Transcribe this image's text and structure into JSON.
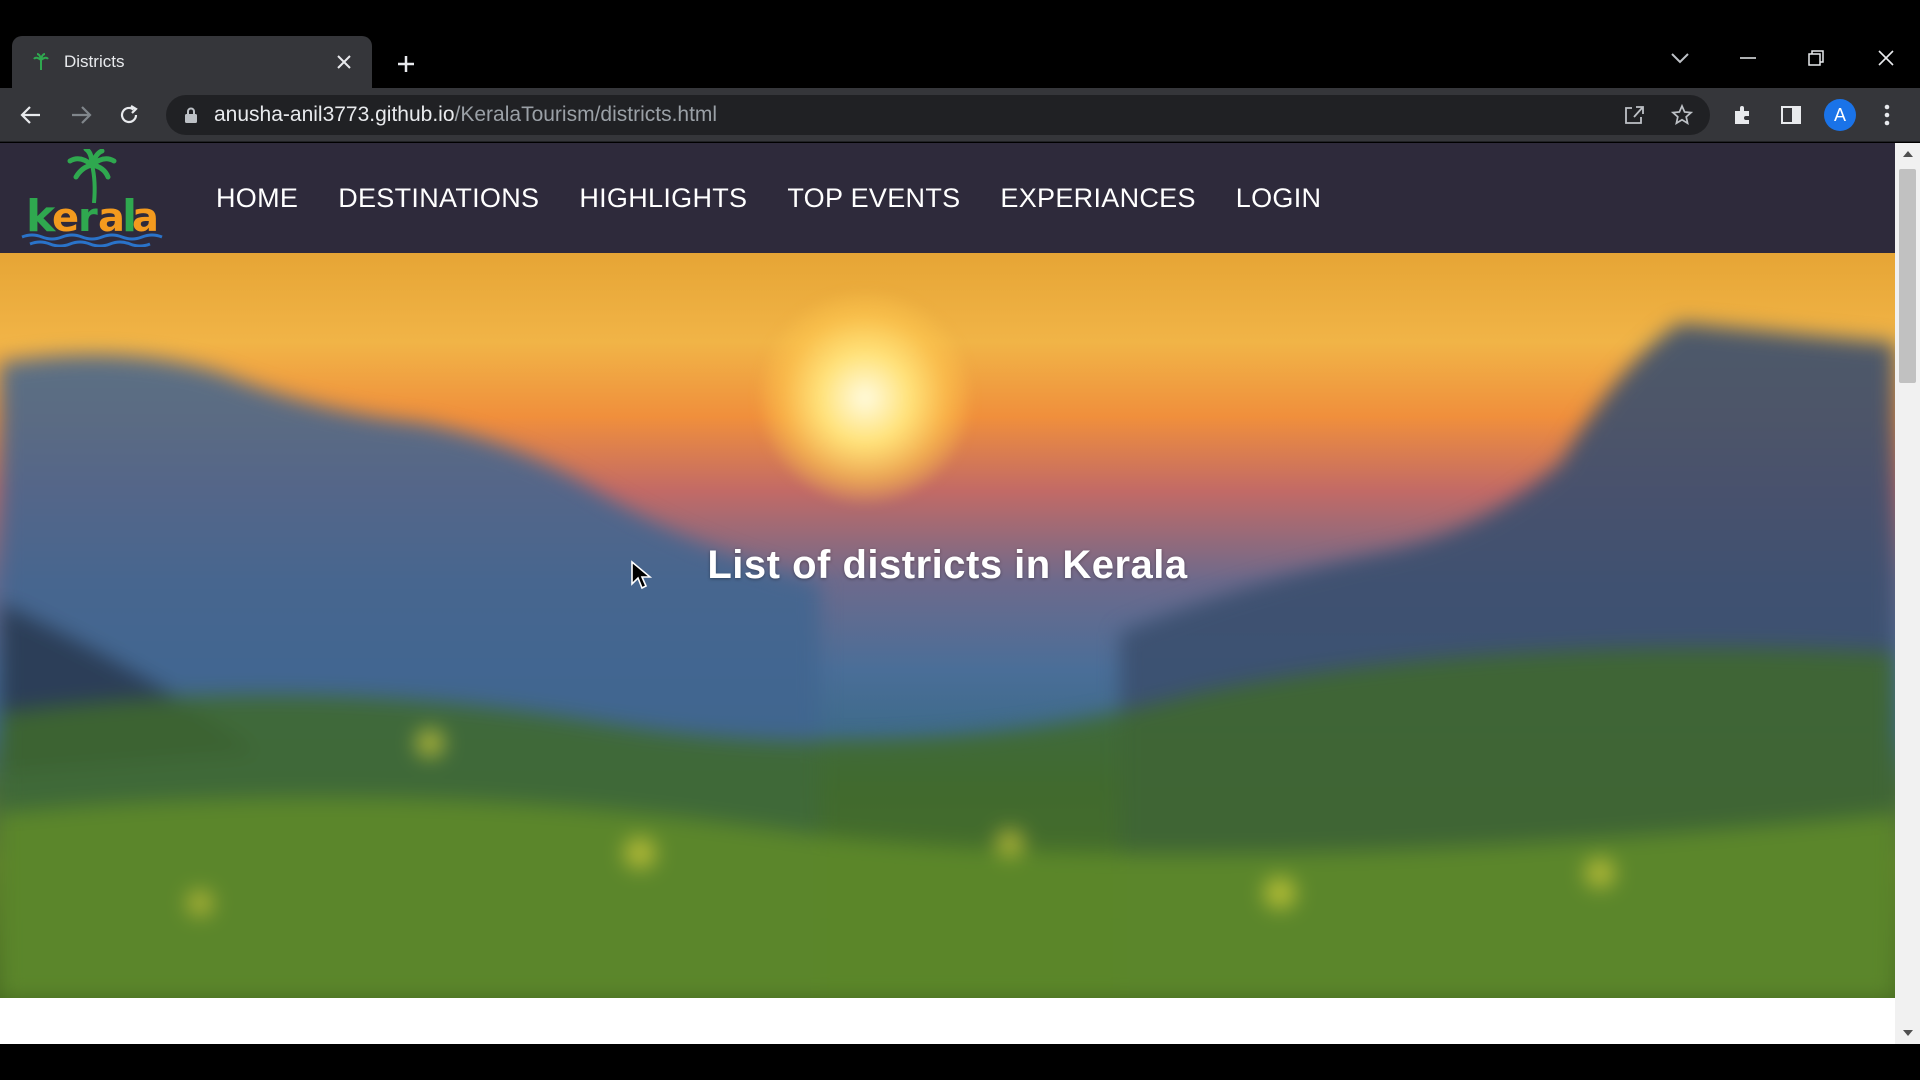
{
  "browser": {
    "tab": {
      "title": "Districts"
    },
    "address": {
      "host": "anusha-anil3773.github.io",
      "path": "/KeralaTourism/districts.html"
    },
    "profile_initial": "A",
    "icons": [
      "back-icon",
      "forward-icon",
      "reload-icon",
      "lock-icon",
      "share-icon",
      "bookmark-star-icon",
      "extensions-icon",
      "side-panel-icon",
      "menu-icon",
      "tab-search-icon",
      "minimize-icon",
      "restore-icon",
      "close-icon",
      "new-tab-icon"
    ]
  },
  "site": {
    "logo_text": "kerala",
    "nav": [
      "HOME",
      "DESTINATIONS",
      "HIGHLIGHTS",
      "TOP EVENTS",
      "EXPERIANCES",
      "LOGIN"
    ],
    "hero_title": "List of districts in Kerala",
    "colors": {
      "header_bg": "#2e2a3b",
      "nav_text": "#ffffff",
      "logo_green": "#2fa84f",
      "logo_orange": "#f39a1e",
      "logo_blue": "#2a73c9"
    }
  }
}
